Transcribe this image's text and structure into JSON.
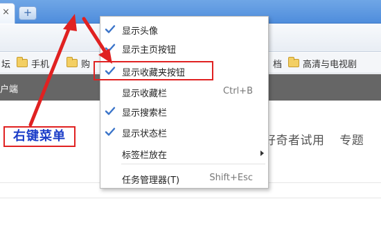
{
  "colors": {
    "tab_strip": "#5b97e0",
    "page_bar": "#666666",
    "check": "#3a74c9",
    "annotation_red": "#e02121",
    "callout_text": "#1a3cc8"
  },
  "tabs": {
    "close_glyph": "×",
    "new_tab_glyph": "+"
  },
  "bookmarks": [
    {
      "label": "坛",
      "icon": "none"
    },
    {
      "label": "手机",
      "icon": "folder-icon"
    },
    {
      "label": "购",
      "icon": "folder-icon"
    },
    {
      "label": "档",
      "icon": "none"
    },
    {
      "label": "高清与电视剧",
      "icon": "folder-icon"
    }
  ],
  "page": {
    "bar_text": "户端",
    "links": [
      "好奇者试用",
      "专题"
    ]
  },
  "context_menu": {
    "items": [
      {
        "label": "显示头像",
        "checked": true,
        "shortcut": "",
        "submenu": false
      },
      {
        "label": "显示主页按钮",
        "checked": true,
        "shortcut": "",
        "submenu": false
      },
      {
        "label": "显示收藏夹按钮",
        "checked": true,
        "shortcut": "",
        "submenu": false,
        "highlighted": true
      },
      {
        "label": "显示收藏栏",
        "checked": false,
        "shortcut": "Ctrl+B",
        "submenu": false
      },
      {
        "label": "显示搜索栏",
        "checked": true,
        "shortcut": "",
        "submenu": false
      },
      {
        "label": "显示状态栏",
        "checked": true,
        "shortcut": "",
        "submenu": false
      },
      {
        "label": "标签栏放在",
        "checked": false,
        "shortcut": "",
        "submenu": true
      },
      {
        "label": "任务管理器(T)",
        "checked": false,
        "shortcut": "Shift+Esc",
        "submenu": false
      }
    ]
  },
  "annotation": {
    "callout_label": "右键菜单"
  }
}
